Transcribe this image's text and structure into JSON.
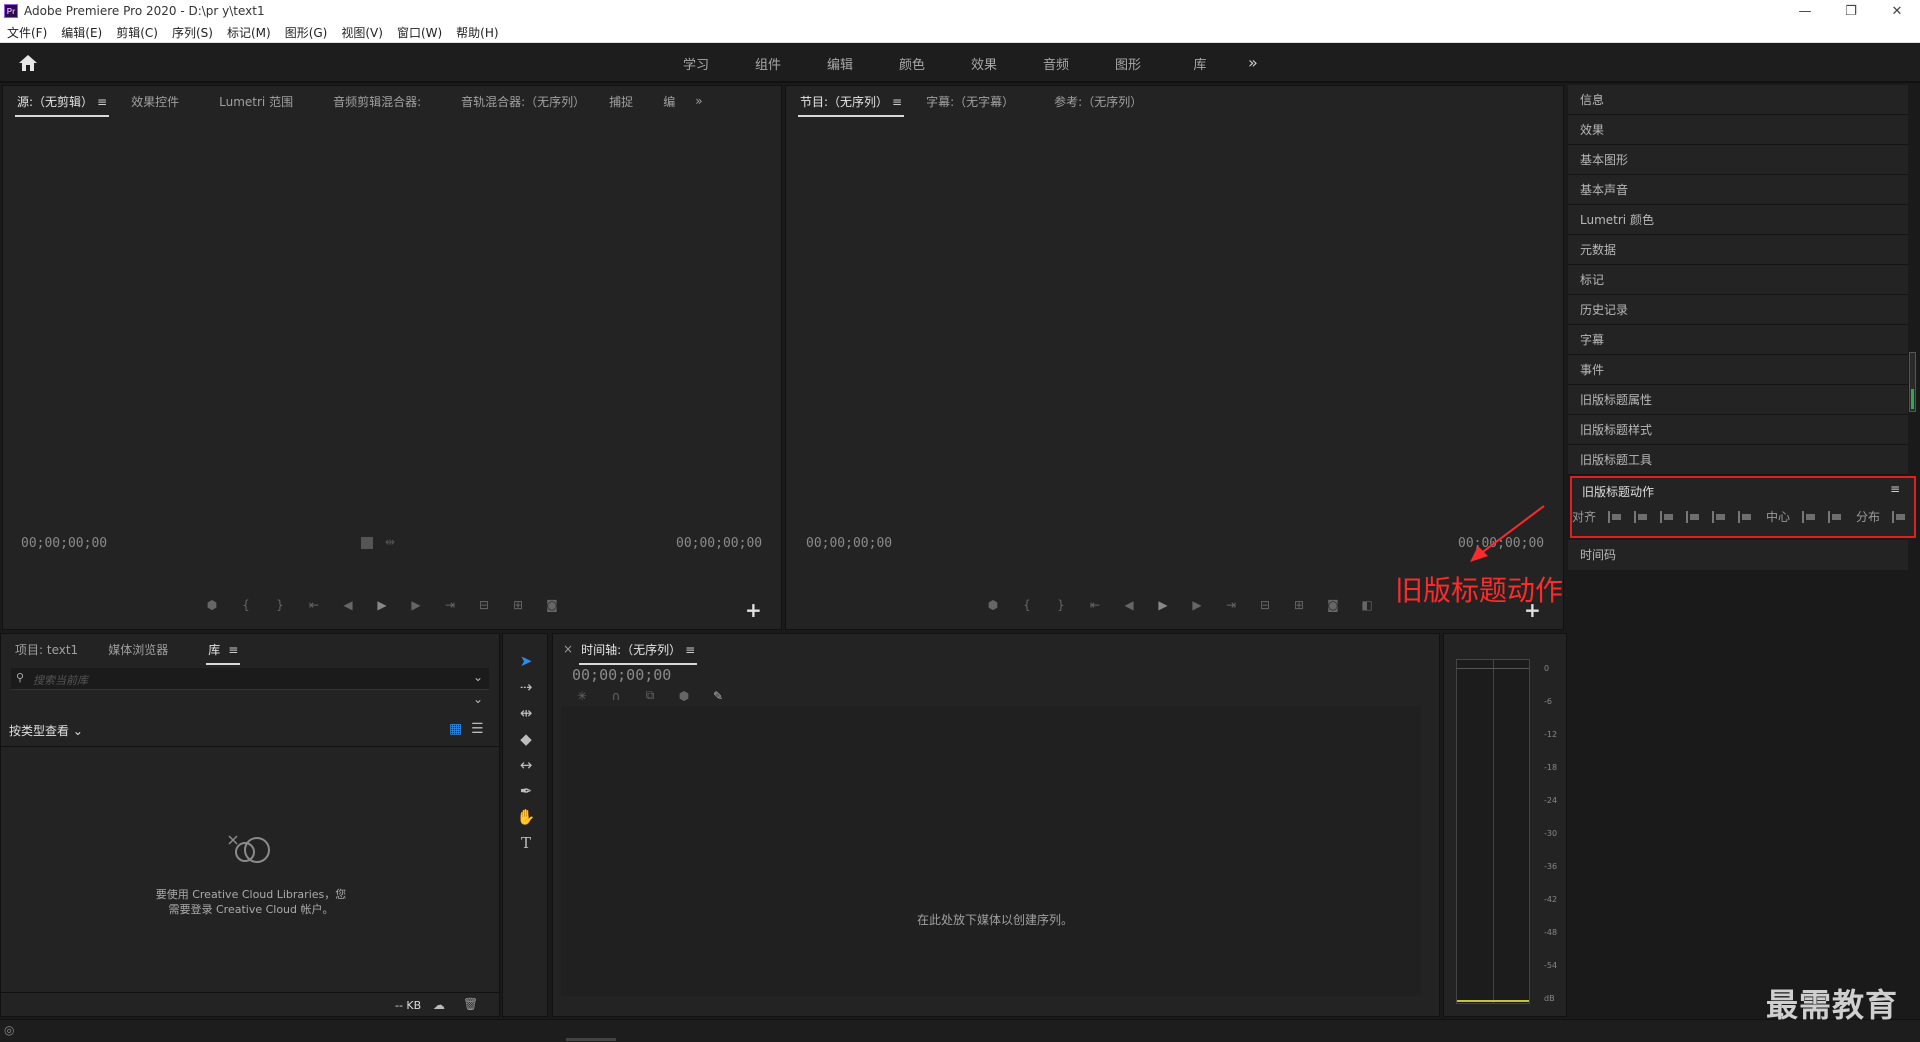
{
  "window": {
    "title": "Adobe Premiere Pro 2020 - D:\\pr y\\text1",
    "app_icon": "Pr",
    "controls": [
      "—",
      "❐",
      "✕"
    ]
  },
  "menu": [
    "文件(F)",
    "编辑(E)",
    "剪辑(C)",
    "序列(S)",
    "标记(M)",
    "图形(G)",
    "视图(V)",
    "窗口(W)",
    "帮助(H)"
  ],
  "workspaces": [
    "学习",
    "组件",
    "编辑",
    "颜色",
    "效果",
    "音频",
    "图形",
    "库"
  ],
  "source_panel": {
    "tabs": [
      "源:（无剪辑）",
      "效果控件",
      "Lumetri 范围",
      "音频剪辑混合器:",
      "音轨混合器:（无序列）",
      "捕捉",
      "编"
    ],
    "timecode_left": "00;00;00;00",
    "timecode_right": "00;00;00;00"
  },
  "program_panel": {
    "tabs": [
      "节目:（无序列）",
      "字幕:（无字幕）",
      "参考:（无序列）"
    ],
    "timecode_left": "00;00;00;00",
    "timecode_right": "00;00;00;00"
  },
  "right_panels": [
    "信息",
    "效果",
    "基本图形",
    "基本声音",
    "Lumetri 颜色",
    "元数据",
    "标记",
    "历史记录",
    "字幕",
    "事件",
    "旧版标题属性",
    "旧版标题样式",
    "旧版标题工具"
  ],
  "legacy_actions": {
    "title": "旧版标题动作",
    "align_label": "对齐",
    "center_label": "中心",
    "distribute_label": "分布"
  },
  "timecode_panel": "时间码",
  "annotation": "旧版标题动作",
  "project_panel": {
    "tabs": [
      "项目: text1",
      "媒体浏览器",
      "库"
    ],
    "search_placeholder": "搜索当前库",
    "view_by": "按类型查看",
    "cc_message_line1": "要使用 Creative Cloud Libraries，您",
    "cc_message_line2": "需要登录 Creative Cloud 帐户。",
    "size_label": "-- KB"
  },
  "timeline": {
    "title": "时间轴:（无序列）",
    "timecode": "00;00;00;00",
    "drop_message": "在此处放下媒体以创建序列。"
  },
  "meter_scale": [
    "0",
    "-6",
    "-12",
    "-18",
    "-24",
    "-30",
    "-36",
    "-42",
    "-48",
    "-54",
    "dB"
  ],
  "watermark": "最需教育",
  "colors": {
    "accent_blue": "#2d8ceb",
    "highlight_red": "#e02020",
    "annotation_red": "#ff2a2a"
  }
}
